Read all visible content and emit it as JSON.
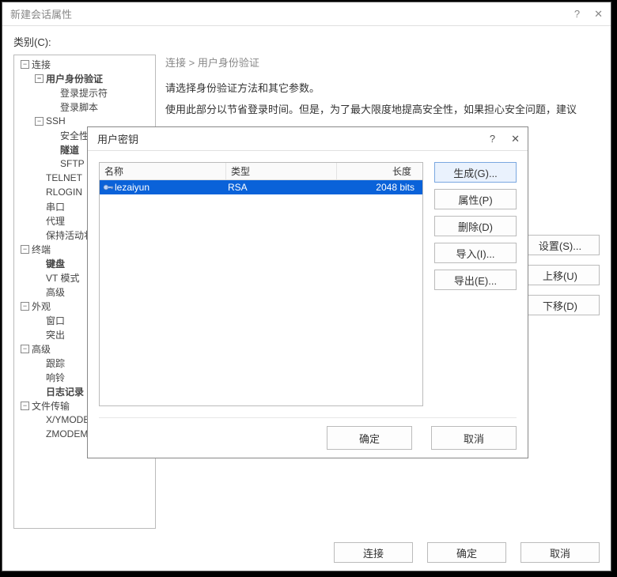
{
  "parent": {
    "title": "新建会话属性",
    "help_glyph": "?",
    "close_glyph": "✕",
    "category_label": "类别(C):",
    "breadcrumb": "连接  >  用户身份验证",
    "desc1": "请选择身份验证方法和其它参数。",
    "desc2": "使用此部分以节省登录时间。但是，为了最大限度地提高安全性，如果担心安全问题，建议",
    "side_buttons": {
      "settings": "设置(S)...",
      "up": "上移(U)",
      "down": "下移(D)"
    },
    "footer": {
      "connect": "连接",
      "ok": "确定",
      "cancel": "取消"
    },
    "tree": [
      {
        "indent": 0,
        "toggle": "−",
        "label": "连接",
        "bold": false
      },
      {
        "indent": 1,
        "toggle": "−",
        "label": "用户身份验证",
        "bold": true
      },
      {
        "indent": 2,
        "toggle": "",
        "label": "登录提示符",
        "bold": false
      },
      {
        "indent": 2,
        "toggle": "",
        "label": "登录脚本",
        "bold": false
      },
      {
        "indent": 1,
        "toggle": "−",
        "label": "SSH",
        "bold": false
      },
      {
        "indent": 2,
        "toggle": "",
        "label": "安全性",
        "bold": false
      },
      {
        "indent": 2,
        "toggle": "",
        "label": "隧道",
        "bold": true
      },
      {
        "indent": 2,
        "toggle": "",
        "label": "SFTP",
        "bold": false
      },
      {
        "indent": 1,
        "toggle": "",
        "label": "TELNET",
        "bold": false
      },
      {
        "indent": 1,
        "toggle": "",
        "label": "RLOGIN",
        "bold": false
      },
      {
        "indent": 1,
        "toggle": "",
        "label": "串口",
        "bold": false
      },
      {
        "indent": 1,
        "toggle": "",
        "label": "代理",
        "bold": false
      },
      {
        "indent": 1,
        "toggle": "",
        "label": "保持活动状态",
        "bold": false
      },
      {
        "indent": 0,
        "toggle": "−",
        "label": "终端",
        "bold": false
      },
      {
        "indent": 1,
        "toggle": "",
        "label": "键盘",
        "bold": true
      },
      {
        "indent": 1,
        "toggle": "",
        "label": "VT 模式",
        "bold": false
      },
      {
        "indent": 1,
        "toggle": "",
        "label": "高级",
        "bold": false
      },
      {
        "indent": 0,
        "toggle": "−",
        "label": "外观",
        "bold": false
      },
      {
        "indent": 1,
        "toggle": "",
        "label": "窗口",
        "bold": false
      },
      {
        "indent": 1,
        "toggle": "",
        "label": "突出",
        "bold": false
      },
      {
        "indent": 0,
        "toggle": "−",
        "label": "高级",
        "bold": false
      },
      {
        "indent": 1,
        "toggle": "",
        "label": "跟踪",
        "bold": false
      },
      {
        "indent": 1,
        "toggle": "",
        "label": "响铃",
        "bold": false
      },
      {
        "indent": 1,
        "toggle": "",
        "label": "日志记录",
        "bold": true
      },
      {
        "indent": 0,
        "toggle": "−",
        "label": "文件传输",
        "bold": false
      },
      {
        "indent": 1,
        "toggle": "",
        "label": "X/YMODEM",
        "bold": false
      },
      {
        "indent": 1,
        "toggle": "",
        "label": "ZMODEM",
        "bold": false
      }
    ]
  },
  "modal": {
    "title": "用户密钥",
    "help_glyph": "?",
    "close_glyph": "✕",
    "columns": {
      "name": "名称",
      "type": "类型",
      "length": "长度"
    },
    "rows": [
      {
        "name": "lezaiyun",
        "type": "RSA",
        "length": "2048 bits",
        "selected": true
      }
    ],
    "buttons": {
      "generate": "生成(G)...",
      "properties": "属性(P)",
      "delete": "删除(D)",
      "import": "导入(I)...",
      "export": "导出(E)..."
    },
    "footer": {
      "ok": "确定",
      "cancel": "取消"
    }
  }
}
